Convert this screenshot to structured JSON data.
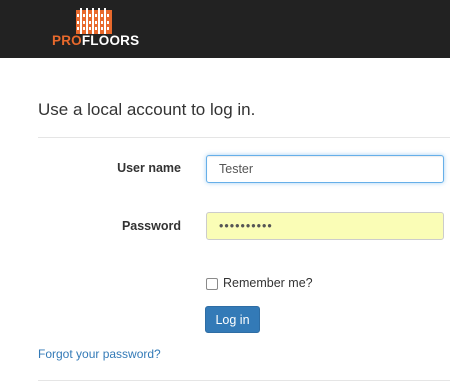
{
  "brand": {
    "pro_text": "PRO",
    "floors_text": "FLOORS",
    "icon": "building-logo-icon",
    "colors": {
      "pro": "#e8692c",
      "floors": "#ffffff",
      "navbar_background": "#222222"
    }
  },
  "main": {
    "heading": "Use a local account to log in."
  },
  "form": {
    "username": {
      "label": "User name",
      "value": "Tester"
    },
    "password": {
      "label": "Password",
      "value": "••••••••••"
    },
    "remember": {
      "label": "Remember me?",
      "checked": false
    },
    "submit_label": "Log in",
    "forgot_label": "Forgot your password?"
  },
  "colors": {
    "primary": "#337ab7",
    "autofill_background": "#fafdb6",
    "focus_border": "#66afe9"
  }
}
